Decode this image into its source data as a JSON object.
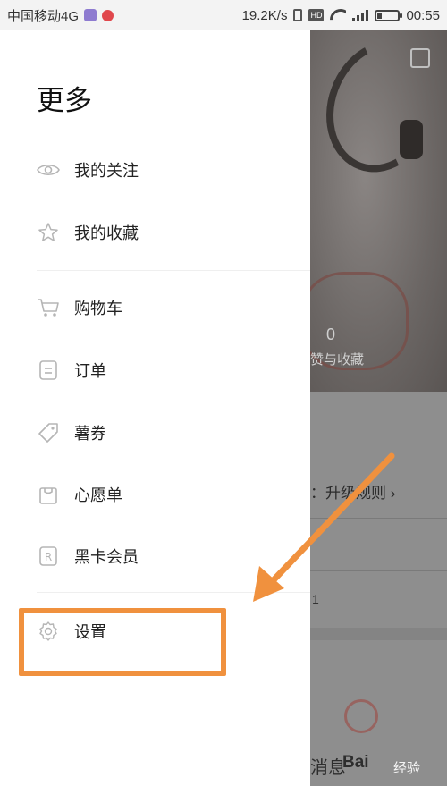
{
  "status_bar": {
    "carrier": "中国移动4G",
    "speed": "19.2K/s",
    "network": "4G",
    "time": "00:55"
  },
  "drawer": {
    "title": "更多",
    "items": [
      {
        "label": "我的关注",
        "icon": "eye-icon"
      },
      {
        "label": "我的收藏",
        "icon": "star-icon"
      },
      {
        "label": "购物车",
        "icon": "cart-icon"
      },
      {
        "label": "订单",
        "icon": "order-icon"
      },
      {
        "label": "薯券",
        "icon": "tag-icon"
      },
      {
        "label": "心愿单",
        "icon": "bag-icon"
      },
      {
        "label": "黑卡会员",
        "icon": "r-badge-icon"
      },
      {
        "label": "设置",
        "icon": "gear-icon"
      }
    ]
  },
  "background": {
    "count": "0",
    "count_label": "赞与收藏",
    "level_text": "：升级规则 ›",
    "number": "1",
    "tab_label": "消息",
    "brand": "Bai",
    "brand_suffix": "经验"
  },
  "annotation": {
    "color": "#f0913e"
  }
}
